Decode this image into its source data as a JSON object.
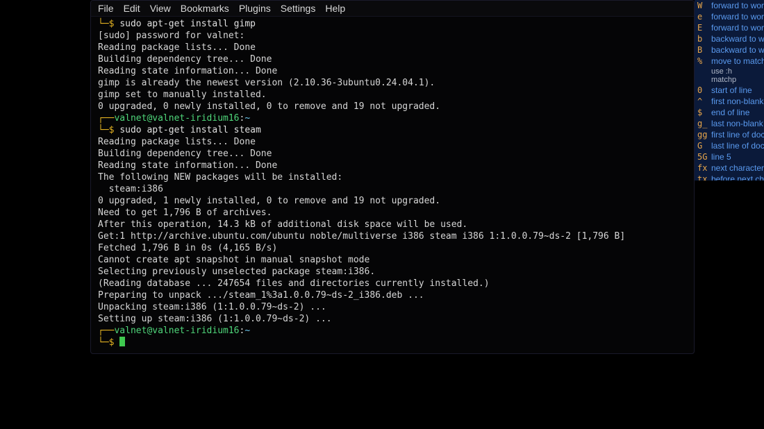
{
  "menubar": [
    "File",
    "Edit",
    "View",
    "Bookmarks",
    "Plugins",
    "Settings",
    "Help"
  ],
  "terminal": {
    "lines": [
      {
        "type": "prompt_cont",
        "dollar": "└─$ ",
        "cmd": "sudo apt-get install gimp"
      },
      {
        "type": "output",
        "text": "[sudo] password for valnet:"
      },
      {
        "type": "output",
        "text": "Reading package lists... Done"
      },
      {
        "type": "output",
        "text": "Building dependency tree... Done"
      },
      {
        "type": "output",
        "text": "Reading state information... Done"
      },
      {
        "type": "output",
        "text": "gimp is already the newest version (2.10.36-3ubuntu0.24.04.1)."
      },
      {
        "type": "output",
        "text": "gimp set to manually installed."
      },
      {
        "type": "output",
        "text": "0 upgraded, 0 newly installed, 0 to remove and 19 not upgraded."
      },
      {
        "type": "prompt_top",
        "branch": "┌──",
        "userhost": "valnet@valnet-iridium16",
        "sep": ":",
        "path": "~"
      },
      {
        "type": "prompt_cont",
        "dollar": "└─$ ",
        "cmd": "sudo apt-get install steam"
      },
      {
        "type": "output",
        "text": "Reading package lists... Done"
      },
      {
        "type": "output",
        "text": "Building dependency tree... Done"
      },
      {
        "type": "output",
        "text": "Reading state information... Done"
      },
      {
        "type": "output",
        "text": "The following NEW packages will be installed:"
      },
      {
        "type": "output",
        "text": "  steam:i386"
      },
      {
        "type": "output",
        "text": "0 upgraded, 1 newly installed, 0 to remove and 19 not upgraded."
      },
      {
        "type": "output",
        "text": "Need to get 1,796 B of archives."
      },
      {
        "type": "output",
        "text": "After this operation, 14.3 kB of additional disk space will be used."
      },
      {
        "type": "output",
        "text": "Get:1 http://archive.ubuntu.com/ubuntu noble/multiverse i386 steam i386 1:1.0.0.79~ds-2 [1,796 B]"
      },
      {
        "type": "output",
        "text": "Fetched 1,796 B in 0s (4,165 B/s)"
      },
      {
        "type": "output",
        "text": "Cannot create apt snapshot in manual snapshot mode"
      },
      {
        "type": "output",
        "text": "Selecting previously unselected package steam:i386."
      },
      {
        "type": "output",
        "text": "(Reading database ... 247654 files and directories currently installed.)"
      },
      {
        "type": "output",
        "text": "Preparing to unpack .../steam_1%3a1.0.0.79~ds-2_i386.deb ..."
      },
      {
        "type": "output",
        "text": "Unpacking steam:i386 (1:1.0.0.79~ds-2) ..."
      },
      {
        "type": "output",
        "text": "Setting up steam:i386 (1:1.0.0.79~ds-2) ..."
      },
      {
        "type": "prompt_top",
        "branch": "┌──",
        "userhost": "valnet@valnet-iridium16",
        "sep": ":",
        "path": "~"
      },
      {
        "type": "prompt_cursor",
        "dollar": "└─$ "
      }
    ]
  },
  "cheatsheet": [
    {
      "key": "W",
      "desc": "forward to wor"
    },
    {
      "key": "e",
      "desc": "forward to wor"
    },
    {
      "key": "E",
      "desc": "forward to wor"
    },
    {
      "key": "b",
      "desc": "backward to w"
    },
    {
      "key": "B",
      "desc": "backward to w"
    },
    {
      "key": "%",
      "desc": "move to matchi"
    },
    {
      "key": "",
      "desc": "use :h matchp",
      "header": true
    },
    {
      "key": "0",
      "desc": "start of line"
    },
    {
      "key": "^",
      "desc": "first non-blank"
    },
    {
      "key": "$",
      "desc": "end of line"
    },
    {
      "key": "g_",
      "desc": "last non-blank"
    },
    {
      "key": "gg",
      "desc": "first line of docu"
    },
    {
      "key": "G",
      "desc": "last line of docu"
    },
    {
      "key": "5G",
      "desc": "line 5"
    },
    {
      "key": "fx",
      "desc": "next character x"
    },
    {
      "key": "tx",
      "desc": "before next char"
    }
  ]
}
